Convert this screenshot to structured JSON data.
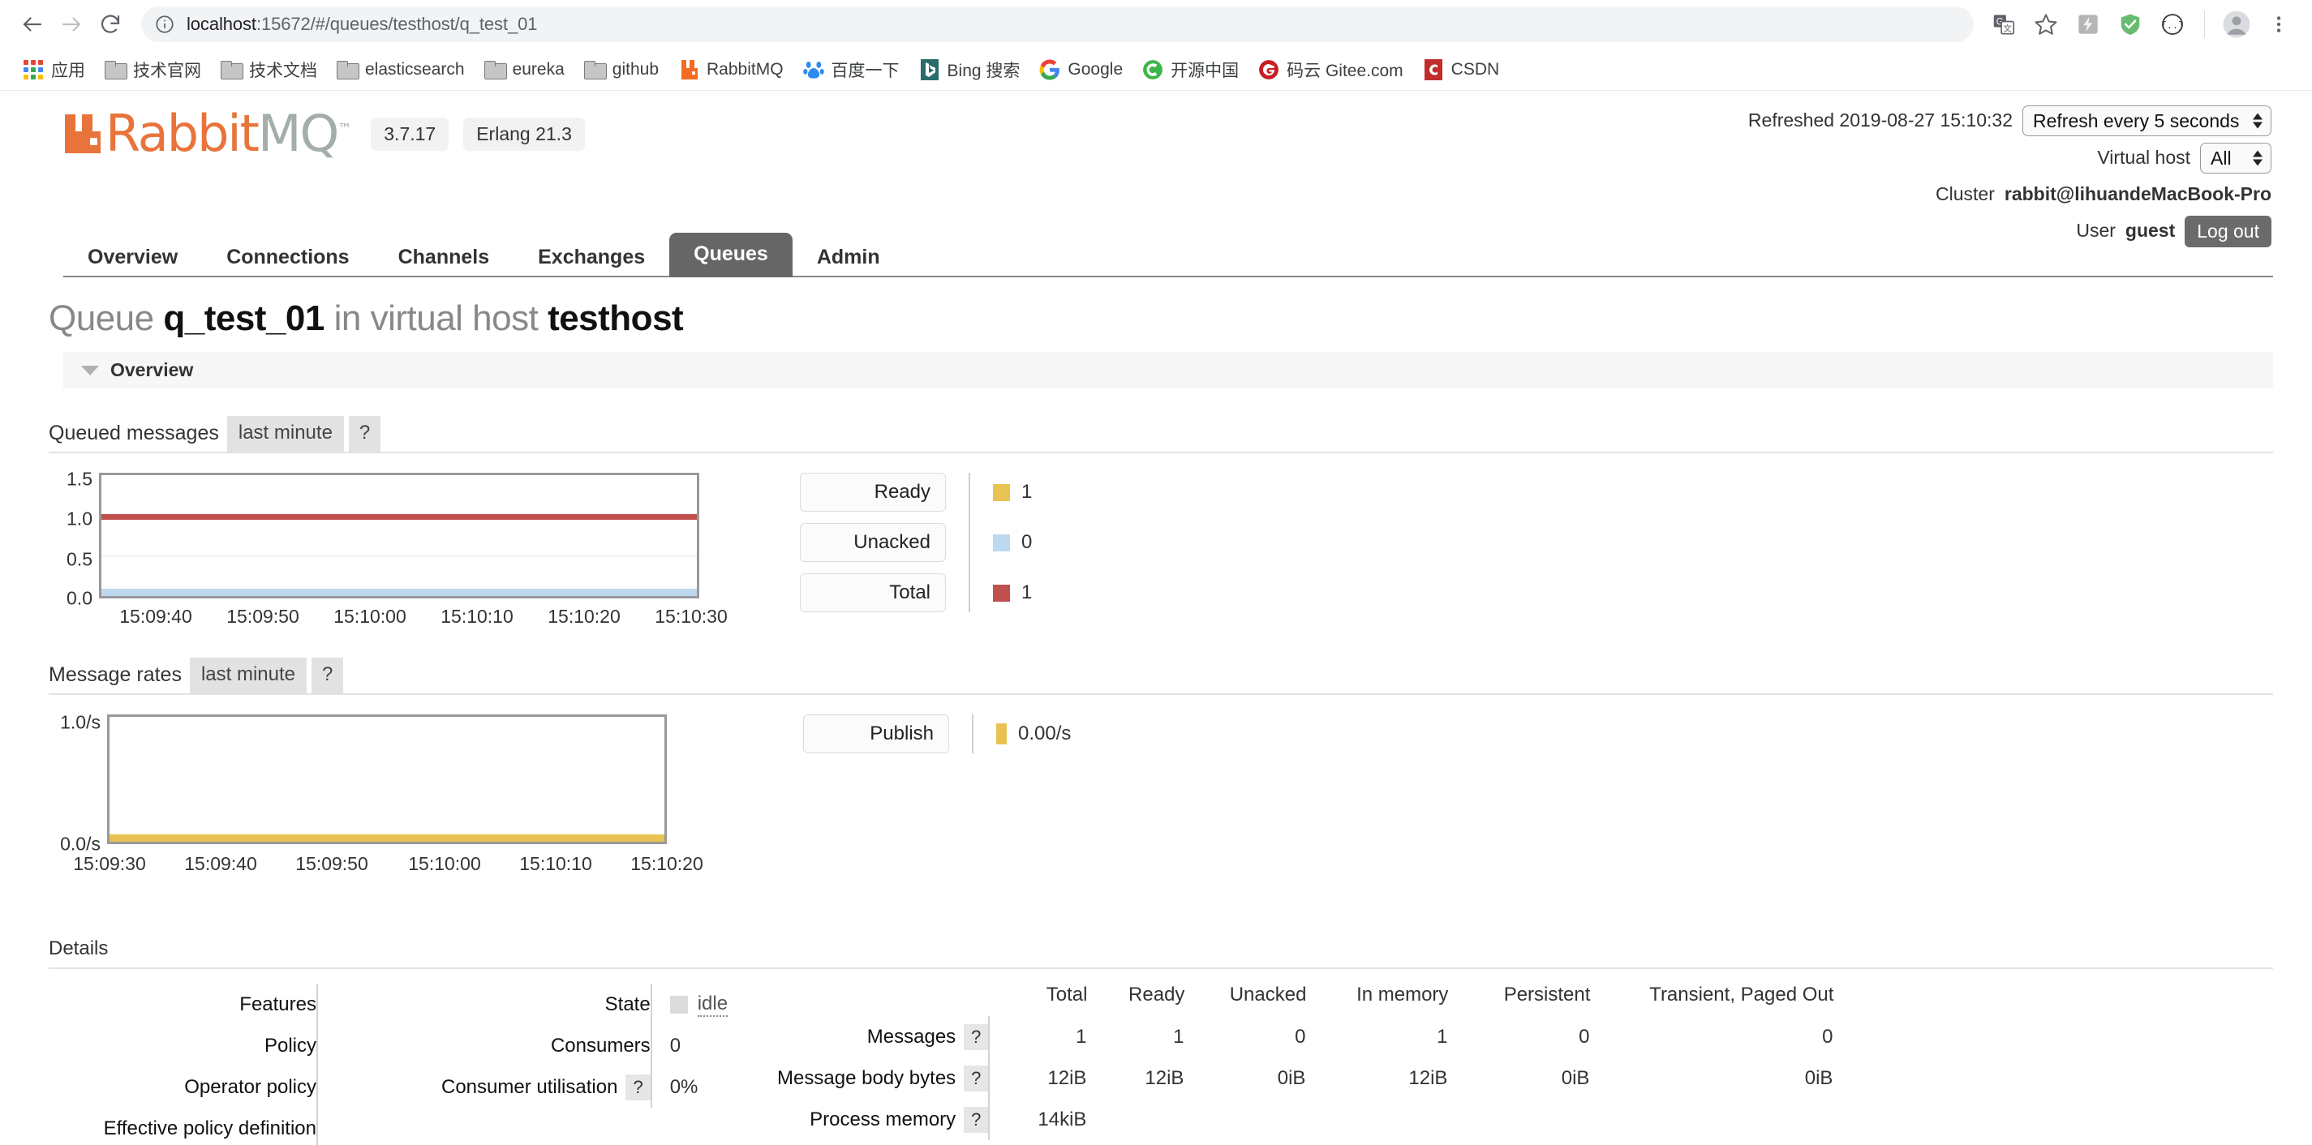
{
  "browser": {
    "url_host": "localhost",
    "url_path": ":15672/#/queues/testhost/q_test_01",
    "back_icon": "back-arrow-icon",
    "forward_icon": "forward-arrow-icon",
    "reload_icon": "reload-icon",
    "info_icon": "site-info-icon",
    "toolbar_icons": [
      "translate-icon",
      "bookmark-star-icon",
      "lightning-extension-icon",
      "adguard-shield-icon",
      "json-viewer-icon",
      "profile-avatar-icon",
      "chrome-menu-icon"
    ]
  },
  "bookmarks": [
    {
      "label": "应用",
      "icon": "apps-grid-icon"
    },
    {
      "label": "技术官网",
      "icon": "folder-icon"
    },
    {
      "label": "技术文档",
      "icon": "folder-icon"
    },
    {
      "label": "elasticsearch",
      "icon": "folder-icon"
    },
    {
      "label": "eureka",
      "icon": "folder-icon"
    },
    {
      "label": "github",
      "icon": "folder-icon"
    },
    {
      "label": "RabbitMQ",
      "icon": "rabbitmq-icon"
    },
    {
      "label": "百度一下",
      "icon": "baidu-icon"
    },
    {
      "label": "Bing 搜索",
      "icon": "bing-icon"
    },
    {
      "label": "Google",
      "icon": "google-icon"
    },
    {
      "label": "开源中国",
      "icon": "oschina-icon"
    },
    {
      "label": "码云 Gitee.com",
      "icon": "gitee-icon"
    },
    {
      "label": "CSDN",
      "icon": "csdn-icon"
    }
  ],
  "header": {
    "logo_rabbit": "Rabbit",
    "logo_mq": "MQ",
    "logo_tm": "™",
    "version": "3.7.17",
    "erlang": "Erlang 21.3",
    "refreshed_label": "Refreshed 2019-08-27 15:10:32",
    "refresh_select": "Refresh every 5 seconds",
    "vhost_label": "Virtual host",
    "vhost_select": "All",
    "cluster_label": "Cluster",
    "cluster_name": "rabbit@lihuandeMacBook-Pro",
    "user_label": "User",
    "user_name": "guest",
    "logout_label": "Log out"
  },
  "nav": {
    "tabs": [
      {
        "label": "Overview",
        "active": false
      },
      {
        "label": "Connections",
        "active": false
      },
      {
        "label": "Channels",
        "active": false
      },
      {
        "label": "Exchanges",
        "active": false
      },
      {
        "label": "Queues",
        "active": true
      },
      {
        "label": "Admin",
        "active": false
      }
    ]
  },
  "page": {
    "title_prefix": "Queue",
    "title_queue": "q_test_01",
    "title_mid": "in virtual host",
    "title_vhost": "testhost",
    "overview_section": "Overview"
  },
  "queued_messages": {
    "title": "Queued messages",
    "period_chip": "last minute",
    "help_chip": "?",
    "buttons": [
      "Ready",
      "Unacked",
      "Total"
    ],
    "values": [
      "1",
      "0",
      "1"
    ],
    "colors": [
      "#e0b martin",
      "#bcd9ef",
      "#c0504d"
    ]
  },
  "message_rates": {
    "title": "Message rates",
    "period_chip": "last minute",
    "help_chip": "?",
    "buttons": [
      "Publish"
    ],
    "values": [
      "0.00/s"
    ]
  },
  "details": {
    "heading": "Details",
    "left_labels": [
      "Features",
      "Policy",
      "Operator policy",
      "Effective policy definition"
    ],
    "mid_labels": [
      "State",
      "Consumers",
      "Consumer utilisation"
    ],
    "mid_values": [
      "idle",
      "0",
      "0%"
    ],
    "consumer_util_help": "?",
    "state_value": "idle"
  },
  "stats_table": {
    "columns": [
      "Total",
      "Ready",
      "Unacked",
      "In memory",
      "Persistent",
      "Transient, Paged Out"
    ],
    "rows": [
      {
        "label": "Messages",
        "help": "?",
        "values": [
          "1",
          "1",
          "0",
          "1",
          "0",
          "0"
        ]
      },
      {
        "label": "Message body bytes",
        "help": "?",
        "values": [
          "12iB",
          "12iB",
          "0iB",
          "12iB",
          "0iB",
          "0iB"
        ]
      },
      {
        "label": "Process memory",
        "help": "?",
        "values": [
          "14kiB",
          "",
          "",
          "",
          "",
          ""
        ]
      }
    ]
  },
  "chart_data": [
    {
      "type": "line",
      "title": "Queued messages",
      "subtitle": "last minute",
      "xlabel": "",
      "ylabel": "",
      "ylim": [
        0.0,
        1.5
      ],
      "yticks": [
        "0.0",
        "0.5",
        "1.0",
        "1.5"
      ],
      "x": [
        "15:09:40",
        "15:09:50",
        "15:10:00",
        "15:10:10",
        "15:10:20",
        "15:10:30"
      ],
      "grid": true,
      "legend": "right",
      "series": [
        {
          "name": "Total",
          "color": "#c0504d",
          "values": [
            1,
            1,
            1,
            1,
            1,
            1
          ],
          "current": "1"
        },
        {
          "name": "Ready",
          "color": "#e8c252",
          "values": [
            1,
            1,
            1,
            1,
            1,
            1
          ],
          "current": "1"
        },
        {
          "name": "Unacked",
          "color": "#bcd9ef",
          "values": [
            0,
            0,
            0,
            0,
            0,
            0
          ],
          "current": "0"
        }
      ]
    },
    {
      "type": "line",
      "title": "Message rates",
      "subtitle": "last minute",
      "xlabel": "",
      "ylabel": "",
      "ylim": [
        0.0,
        1.0
      ],
      "yticks": [
        "0.0/s",
        "1.0/s"
      ],
      "x": [
        "15:09:30",
        "15:09:40",
        "15:09:50",
        "15:10:00",
        "15:10:10",
        "15:10:20"
      ],
      "grid": false,
      "legend": "right",
      "series": [
        {
          "name": "Publish",
          "color": "#e8c252",
          "values": [
            0,
            0,
            0,
            0,
            0,
            0
          ],
          "current": "0.00/s"
        }
      ]
    }
  ]
}
